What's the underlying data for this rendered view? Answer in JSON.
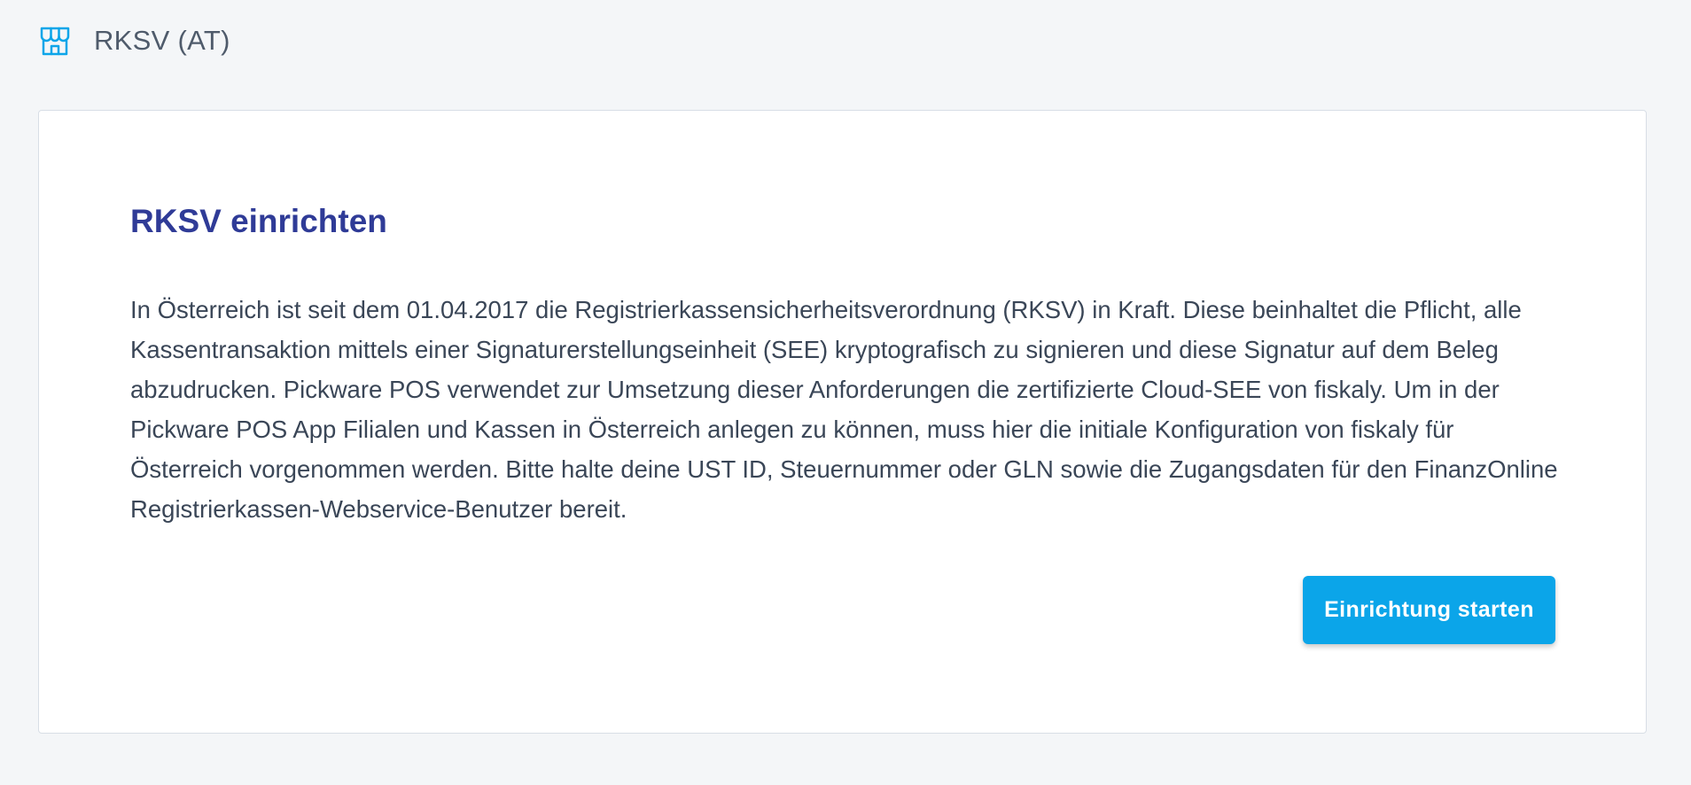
{
  "header": {
    "icon": "store-icon",
    "title": "RKSV (AT)"
  },
  "card": {
    "title": "RKSV einrichten",
    "description": "In Österreich ist seit dem 01.04.2017 die Registrierkassensicherheitsverordnung (RKSV) in Kraft. Diese beinhaltet die Pflicht, alle Kassentransaktion mittels einer Signaturerstellungseinheit (SEE) kryptografisch zu signieren und diese Signatur auf dem Beleg abzudrucken. Pickware POS verwendet zur Umsetzung dieser Anforderungen die zertifizierte Cloud-SEE von fiskaly. Um in der Pickware POS App Filialen und Kassen in Österreich anlegen zu können, muss hier die initiale Konfiguration von fiskaly für Österreich vorgenommen werden. Bitte halte deine UST ID, Steuernummer oder GLN sowie die Zugangsdaten für den FinanzOnline Registrierkassen-Webservice-Benutzer bereit.",
    "button_label": "Einrichtung starten"
  },
  "colors": {
    "background": "#f4f6f8",
    "card": "#ffffff",
    "accent": "#0ba5e9",
    "title": "#2f3b97",
    "text": "#3a4657"
  }
}
